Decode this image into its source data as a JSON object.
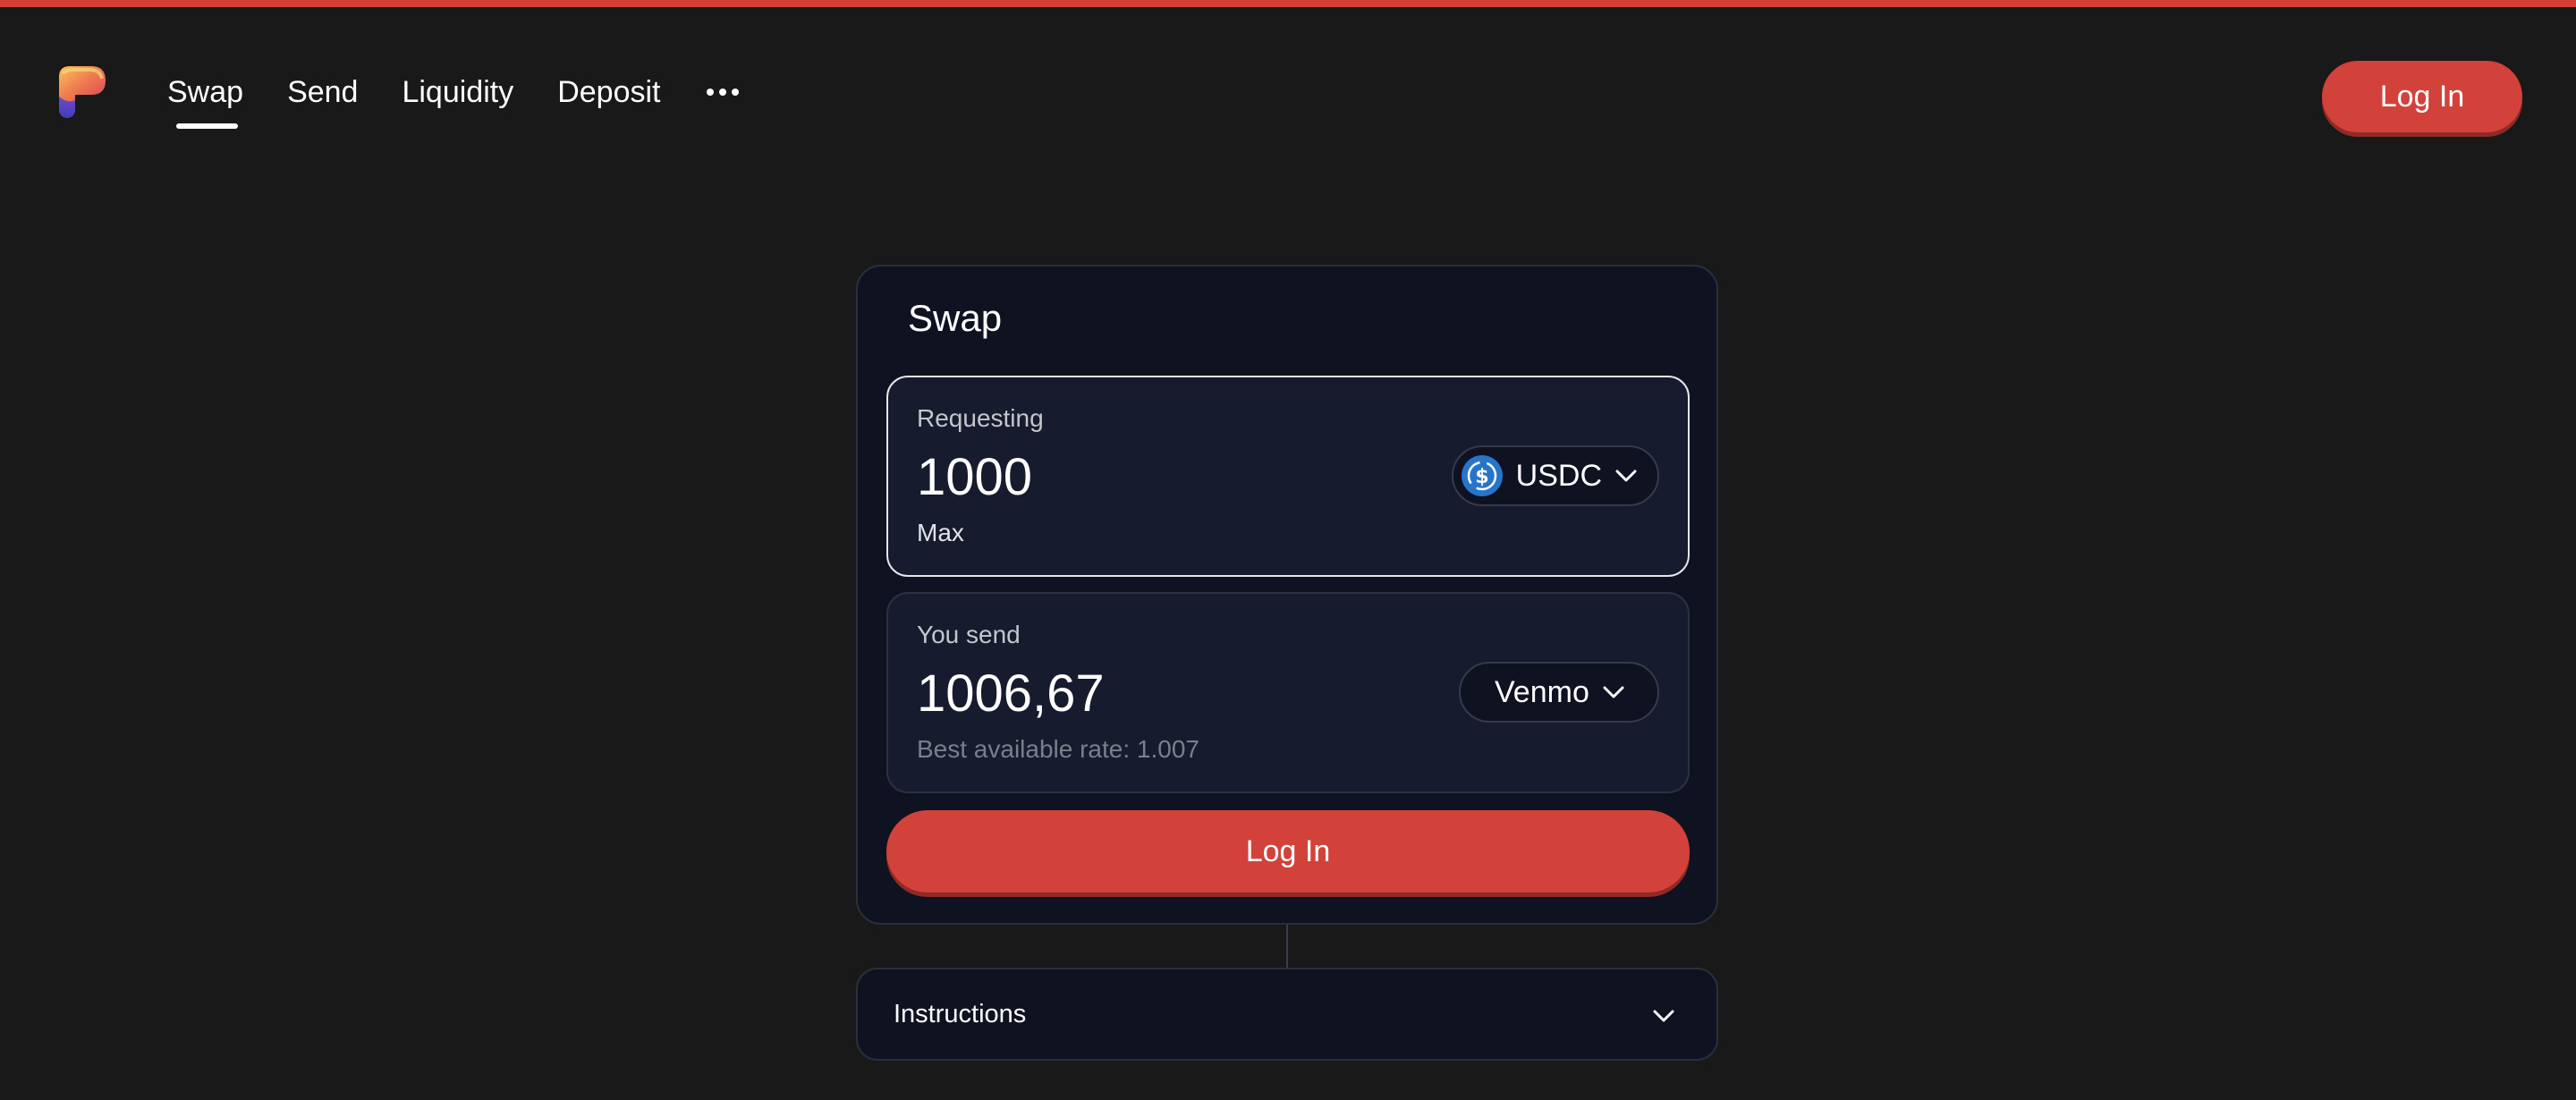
{
  "nav": {
    "logo_name": "app-logo",
    "links": [
      {
        "label": "Swap",
        "active": true
      },
      {
        "label": "Send",
        "active": false
      },
      {
        "label": "Liquidity",
        "active": false
      },
      {
        "label": "Deposit",
        "active": false
      }
    ],
    "more_icon": "more-horizontal-icon",
    "login_label": "Log In"
  },
  "swap": {
    "title": "Swap",
    "requesting": {
      "label": "Requesting",
      "amount": "1000",
      "max_label": "Max",
      "token": "USDC",
      "token_icon": "usdc-icon"
    },
    "send": {
      "label": "You send",
      "amount": "1006,67",
      "rate_text": "Best available rate: 1.007",
      "method": "Venmo"
    },
    "login_label": "Log In"
  },
  "instructions": {
    "label": "Instructions"
  },
  "colors": {
    "accent": "#d2413a",
    "background": "#191919",
    "card": "#0f1220",
    "field": "#161b2d",
    "usdc_blue": "#2775ca"
  }
}
